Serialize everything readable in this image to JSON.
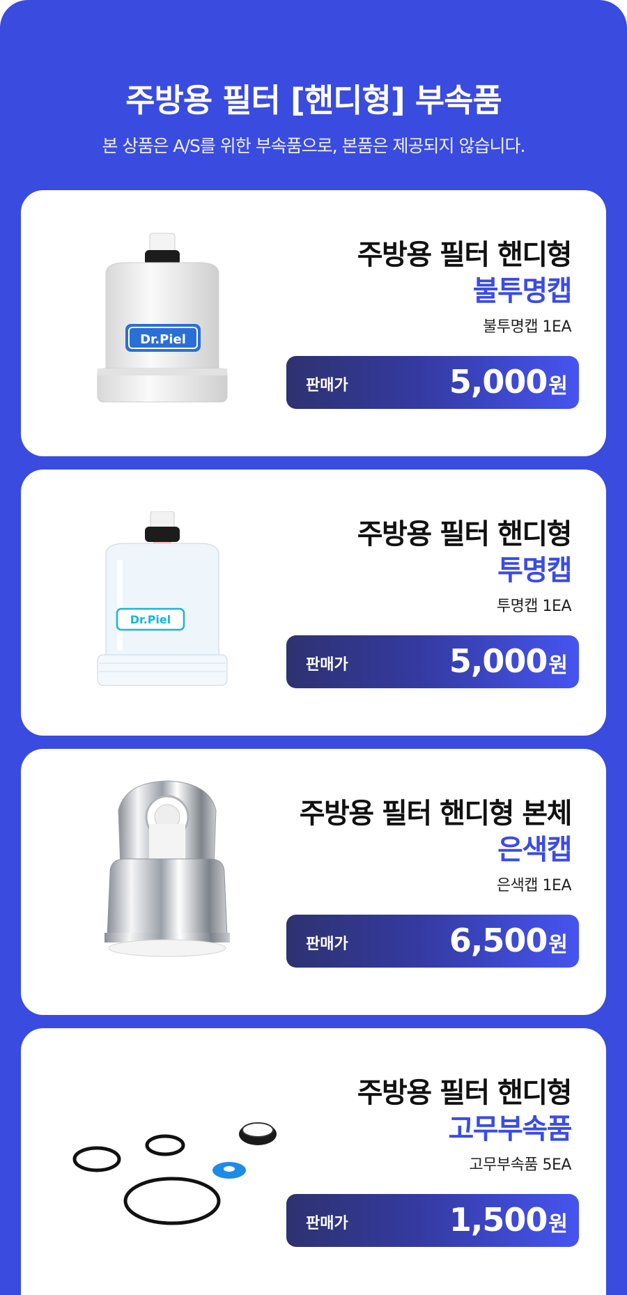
{
  "header": {
    "title": "주방용 필터 [핸디형] 부속품",
    "subtitle": "본 상품은 A/S를 위한 부속품으로, 본품은 제공되지 않습니다."
  },
  "products": [
    {
      "name_line1": "주방용 필터 핸디형",
      "name_line2": "불투명캡",
      "quantity": "불투명캡 1EA",
      "price_label": "판매가",
      "price": "5,000",
      "currency": "원",
      "logo": "Dr.Piel"
    },
    {
      "name_line1": "주방용 필터 핸디형",
      "name_line2": "투명캡",
      "quantity": "투명캡 1EA",
      "price_label": "판매가",
      "price": "5,000",
      "currency": "원",
      "logo": "Dr.Piel"
    },
    {
      "name_line1": "주방용 필터 핸디형 본체",
      "name_line2": "은색캡",
      "quantity": "은색캡 1EA",
      "price_label": "판매가",
      "price": "6,500",
      "currency": "원"
    },
    {
      "name_line1": "주방용 필터 핸디형",
      "name_line2": "고무부속품",
      "quantity": "고무부속품 5EA",
      "price_label": "판매가",
      "price": "1,500",
      "currency": "원"
    }
  ],
  "colors": {
    "background": "#3a4be0",
    "accent": "#3b4be6",
    "card": "#ffffff"
  }
}
